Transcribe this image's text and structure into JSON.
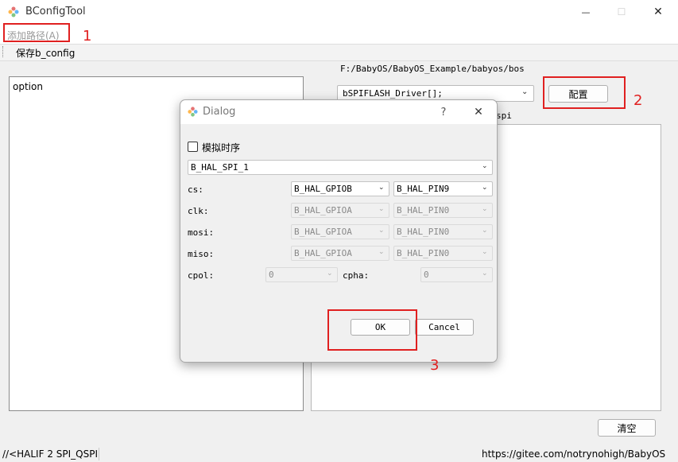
{
  "window": {
    "title": "BConfigTool",
    "minimize_glyph": "—",
    "maximize_glyph": "☐",
    "close_glyph": "✕"
  },
  "menu": {
    "add_path": "添加路径(A)"
  },
  "toolbar": {
    "save": "保存b_config"
  },
  "main": {
    "option_text": "option",
    "path": "F:/BabyOS/BabyOS_Example/babyos/bos",
    "driver_combo": "bSPIFLASH_Driver[];",
    "config_button": "配置",
    "sub_label": "spi",
    "clear_button": "清空"
  },
  "status": {
    "left": "//<HALIF 2 SPI_QSPI",
    "right": "https://gitee.com/notrynohigh/BabyOS"
  },
  "dialog": {
    "title": "Dialog",
    "help": "?",
    "close": "✕",
    "simulate_timing": "模拟时序",
    "spi_select": "B_HAL_SPI_1",
    "rows": [
      {
        "label": "cs:",
        "port": "B_HAL_GPIOB",
        "pin": "B_HAL_PIN9"
      },
      {
        "label": "clk:",
        "port": "B_HAL_GPIOA",
        "pin": "B_HAL_PIN0"
      },
      {
        "label": "mosi:",
        "port": "B_HAL_GPIOA",
        "pin": "B_HAL_PIN0"
      },
      {
        "label": "miso:",
        "port": "B_HAL_GPIOA",
        "pin": "B_HAL_PIN0"
      }
    ],
    "cpol_label": "cpol:",
    "cpol_value": "0",
    "cpha_label": "cpha:",
    "cpha_value": "0",
    "ok": "OK",
    "cancel": "Cancel"
  },
  "annotations": [
    "1",
    "2",
    "3"
  ],
  "colors": {
    "annotation": "#e02020",
    "dialog_bg": "#f0f0f0"
  },
  "icons": {
    "app": "app-logo-icon",
    "dropdown": "chevron-down-icon"
  }
}
